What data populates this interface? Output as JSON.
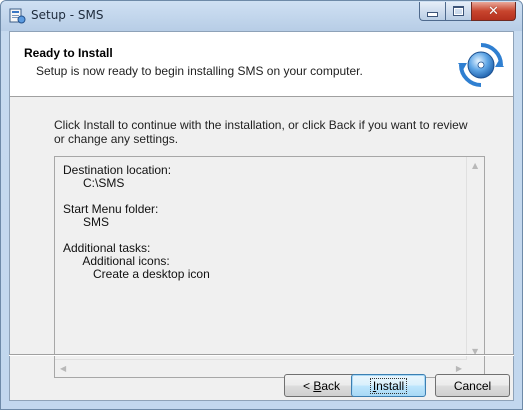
{
  "window": {
    "title": "Setup - SMS"
  },
  "header": {
    "title": "Ready to Install",
    "subtitle": "Setup is now ready to begin installing SMS on your computer."
  },
  "intro_text": "Click Install to continue with the installation, or click Back if you want to review or change any settings.",
  "memo": {
    "text": "Destination location:\n      C:\\SMS\n\nStart Menu folder:\n      SMS\n\nAdditional tasks:\n      Additional icons:\n         Create a desktop icon"
  },
  "buttons": {
    "back_prefix": "< ",
    "back_access": "B",
    "back_rest": "ack",
    "install_access": "I",
    "install_rest": "nstall",
    "cancel": "Cancel"
  },
  "icons": {
    "app": "setup-app-icon",
    "header": "install-disc-icon"
  },
  "colors": {
    "title_bar": "#b9d1ea",
    "close_button": "#c8452e",
    "default_button_border": "#3c7fb1"
  }
}
